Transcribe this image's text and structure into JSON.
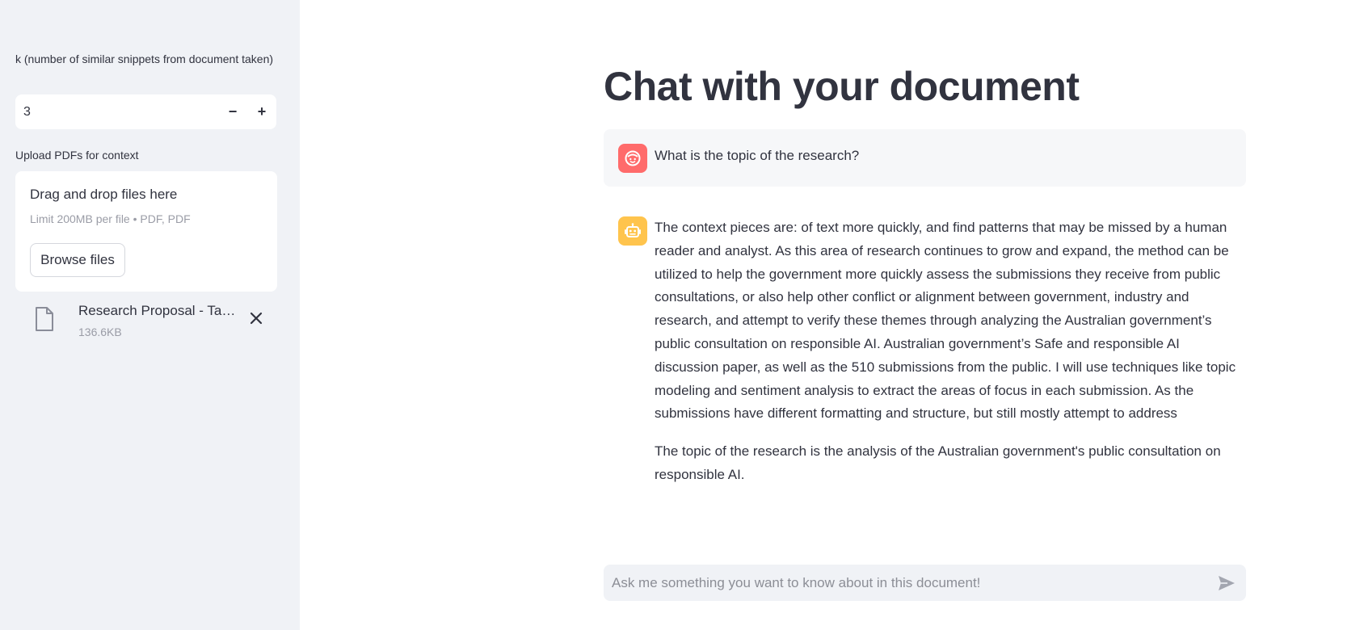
{
  "sidebar": {
    "k_input": {
      "label": "k (number of similar snippets from document taken)",
      "value": "3",
      "decrement": "−",
      "increment": "+"
    },
    "uploader": {
      "label": "Upload PDFs for context",
      "dropzone_title": "Drag and drop files here",
      "dropzone_limit": "Limit 200MB per file • PDF, PDF",
      "browse_label": "Browse files"
    },
    "files": [
      {
        "name": "Research Proposal - Taylor",
        "size": "136.6KB"
      }
    ]
  },
  "main": {
    "title": "Chat with your document",
    "messages": [
      {
        "role": "user",
        "avatar_icon": "user-face-icon",
        "text": "What is the topic of the research?"
      },
      {
        "role": "assistant",
        "avatar_icon": "robot-icon",
        "paragraphs": [
          "The context pieces are: of text more quickly, and find patterns that may be missed by a human reader and analyst. As this area of research continues to grow and expand, the method can be utilized to help the government more quickly assess the submissions they receive from public consultations, or also help other conflict or alignment between government, industry and research, and attempt to verify these themes through analyzing the Australian government’s public consultation on responsible AI. Australian government’s Safe and responsible AI discussion paper, as well as the 510 submissions from the public. I will use techniques like topic modeling and sentiment analysis to extract the areas of focus in each submission. As the submissions have different formatting and structure, but still mostly attempt to address",
          "The topic of the research is the analysis of the Australian government's public consultation on responsible AI."
        ]
      }
    ],
    "chat_input": {
      "placeholder": "Ask me something you want to know about in this document!",
      "value": ""
    }
  },
  "colors": {
    "sidebar_bg": "#f0f2f6",
    "user_avatar": "#ff6b6b",
    "bot_avatar": "#ffc44d",
    "text": "#31333f",
    "muted": "#9a9ca6"
  }
}
